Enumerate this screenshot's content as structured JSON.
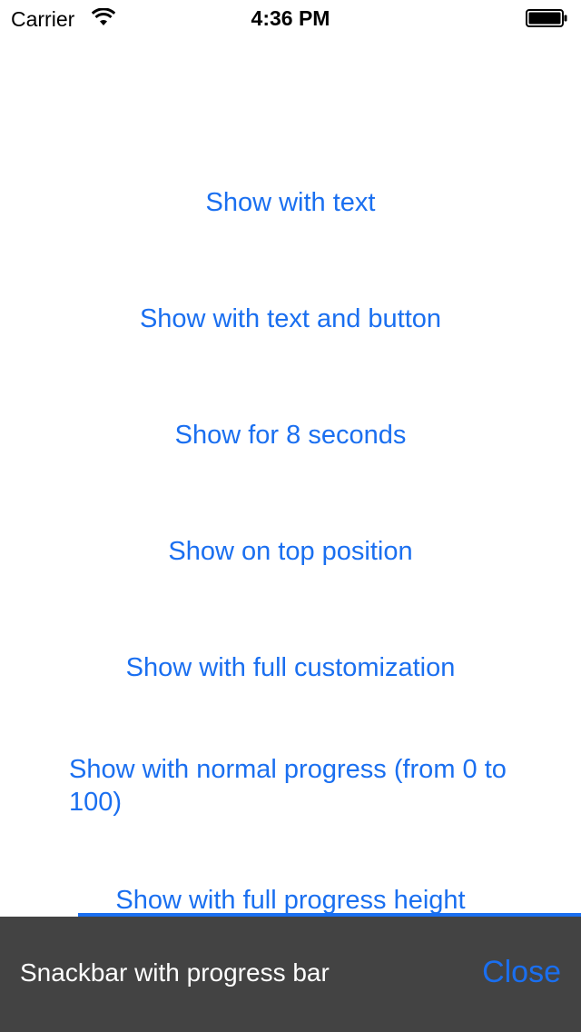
{
  "status_bar": {
    "carrier": "Carrier",
    "time": "4:36 PM",
    "wifi_icon": "wifi-icon",
    "battery_icon": "battery-icon"
  },
  "buttons": [
    "Show with text",
    "Show with text and button",
    "Show for 8 seconds",
    "Show on top position",
    "Show with full customization",
    "Show with normal progress (from 0 to 100)",
    "Show with full progress height"
  ],
  "snackbar": {
    "message": "Snackbar with progress bar",
    "close_label": "Close",
    "progress": 0.865
  },
  "colors": {
    "accent": "#1a6ff0",
    "snackbar_bg": "#434343",
    "background": "#ffffff"
  }
}
